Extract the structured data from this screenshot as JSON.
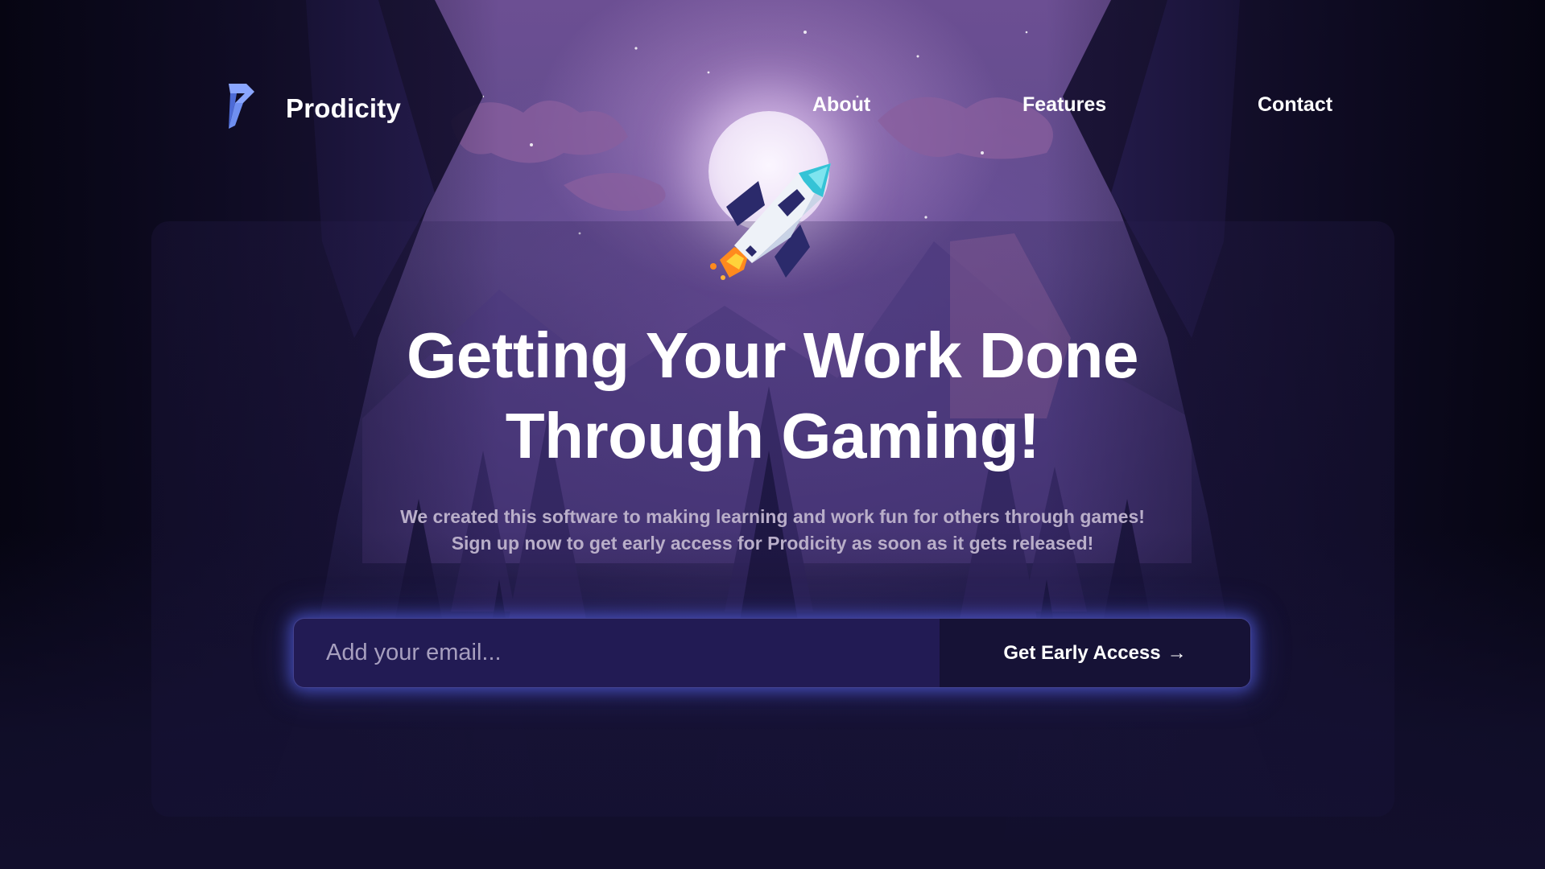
{
  "brand": {
    "name": "Prodicity"
  },
  "nav": {
    "items": [
      "About",
      "Features",
      "Contact"
    ]
  },
  "hero": {
    "headline_line1": "Getting Your Work Done",
    "headline_line2": "Through Gaming!",
    "subtext_line1": "We created this software to making learning and work fun for others through games!",
    "subtext_line2": "Sign up now to get early access for Prodicity as soon as it gets released!"
  },
  "signup": {
    "email_placeholder": "Add your email...",
    "email_value": "",
    "button_label": "Get Early Access",
    "button_arrow": "→"
  },
  "icons": {
    "logo": "prodicity-logo-icon",
    "rocket": "rocket-icon"
  },
  "colors": {
    "accent_glow": "#5c6eff",
    "form_bg": "#221b54",
    "button_bg": "#161236"
  }
}
